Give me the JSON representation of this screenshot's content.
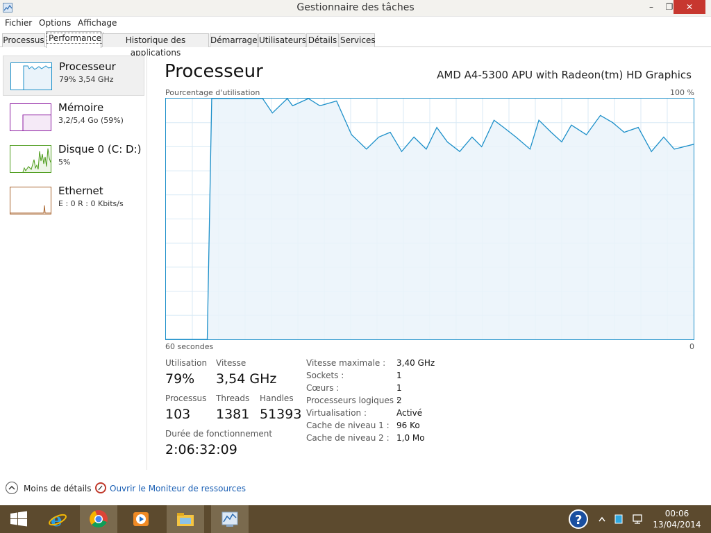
{
  "window": {
    "title": "Gestionnaire des tâches",
    "minimize": "–",
    "maximize": "❐",
    "close": "✕"
  },
  "menu": [
    "Fichier",
    "Options",
    "Affichage"
  ],
  "tabs": [
    {
      "label": "Processus",
      "active": false
    },
    {
      "label": "Performance",
      "active": true
    },
    {
      "label": "Historique des applications",
      "active": false
    },
    {
      "label": "Démarrage",
      "active": false
    },
    {
      "label": "Utilisateurs",
      "active": false
    },
    {
      "label": "Détails",
      "active": false
    },
    {
      "label": "Services",
      "active": false
    }
  ],
  "resources": [
    {
      "name": "Processeur",
      "sub": "79% 3,54 GHz",
      "color": "#1b8fc9",
      "fill": "#eaf3fa"
    },
    {
      "name": "Mémoire",
      "sub": "3,2/5,4 Go (59%)",
      "color": "#8b1aa0",
      "fill": "#f5eaf7",
      "level": 0.59
    },
    {
      "name": "Disque 0 (C: D:)",
      "sub": "5%",
      "color": "#4a9a18",
      "fill": "#edf5e7"
    },
    {
      "name": "Ethernet",
      "sub": "E : 0 R : 0 Kbits/s",
      "color": "#a7622b",
      "fill": "#fff"
    }
  ],
  "main": {
    "title": "Processeur",
    "cpu_model": "AMD A4-5300 APU with Radeon(tm) HD Graphics",
    "y_label": "Pourcentage d'utilisation",
    "y_max_label": "100 %",
    "x_left_label": "60 secondes",
    "x_right_label": "0"
  },
  "chart_data": {
    "type": "area",
    "ylim": [
      0,
      100
    ],
    "x": [
      60,
      55.3,
      54.8,
      50,
      49,
      47.9,
      46.2,
      45.6,
      43.8,
      42.5,
      40.6,
      38.9,
      37.2,
      35.8,
      34.5,
      33.2,
      31.8,
      30.4,
      29.2,
      28,
      26.6,
      25.2,
      24.1,
      22.7,
      21.6,
      20.2,
      18.6,
      17.6,
      16.2,
      15,
      13.9,
      12.2,
      10.6,
      9.2,
      7.9,
      6.3,
      4.8,
      3.4,
      2.2,
      0
    ],
    "y": [
      0,
      0,
      100,
      100,
      100,
      94,
      100,
      97,
      100,
      97,
      99,
      85,
      79,
      84,
      86,
      78,
      84,
      79,
      88,
      82,
      78,
      84,
      80,
      91,
      88,
      84,
      79,
      91,
      86,
      82,
      89,
      85,
      93,
      90,
      86,
      88,
      78,
      84,
      79,
      81
    ]
  },
  "stats": {
    "utilisation": {
      "label": "Utilisation",
      "value": "79%"
    },
    "vitesse": {
      "label": "Vitesse",
      "value": "3,54 GHz"
    },
    "processus": {
      "label": "Processus",
      "value": "103"
    },
    "threads": {
      "label": "Threads",
      "value": "1381"
    },
    "handles": {
      "label": "Handles",
      "value": "51393"
    },
    "uptime": {
      "label": "Durée de fonctionnement",
      "value": "2:06:32:09"
    }
  },
  "details": [
    {
      "key": "Vitesse maximale :",
      "value": "3,40 GHz"
    },
    {
      "key": "Sockets :",
      "value": "1"
    },
    {
      "key": "Cœurs :",
      "value": "1"
    },
    {
      "key": "Processeurs logiques :",
      "value": "2"
    },
    {
      "key": "Virtualisation :",
      "value": "Activé"
    },
    {
      "key": "Cache de niveau 1 :",
      "value": "96 Ko"
    },
    {
      "key": "Cache de niveau 2 :",
      "value": "1,0 Mo"
    }
  ],
  "footer": {
    "less_details": "Moins de détails",
    "monitor_link": "Ouvrir le Moniteur de ressources"
  },
  "taskbar": {
    "time": "00:06",
    "date": "13/04/2014",
    "apps": [
      "start-icon",
      "internet-explorer-icon",
      "chrome-icon",
      "media-player-icon",
      "file-explorer-icon",
      "task-manager-icon"
    ]
  }
}
